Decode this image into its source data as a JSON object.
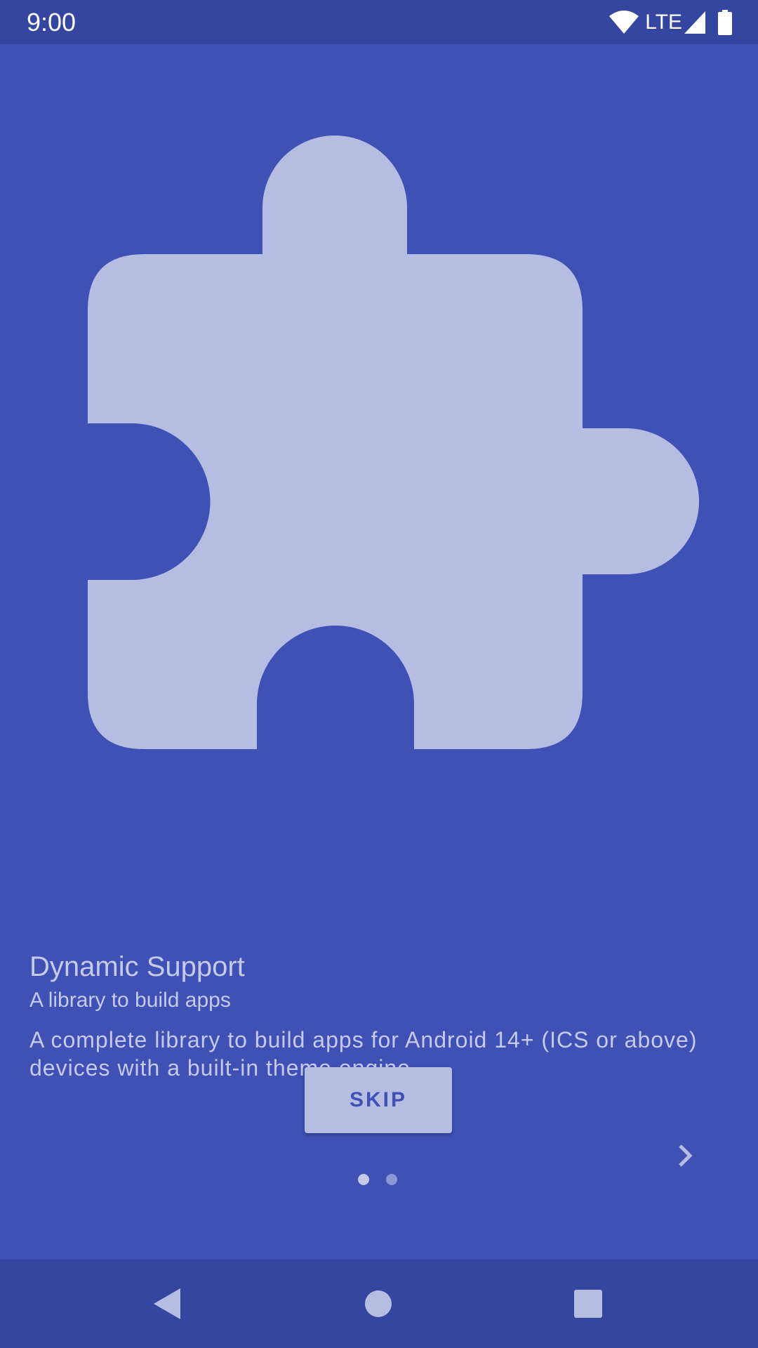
{
  "status_bar": {
    "time": "9:00",
    "network_label": "LTE",
    "icons": [
      "wifi-icon",
      "signal-icon",
      "battery-icon"
    ]
  },
  "intro": {
    "illustration_icon": "puzzle-piece-icon",
    "title": "Dynamic Support",
    "subtitle": "A library to build apps",
    "description": "A complete library to build apps for Android 14+ (ICS or above) devices with a built-in theme engine."
  },
  "controls": {
    "skip_label": "SKIP",
    "next_icon": "chevron-right-icon",
    "page_count": 2,
    "current_page": 1
  },
  "nav_bar": {
    "icons": [
      "back-icon",
      "home-icon",
      "recents-icon"
    ]
  },
  "colors": {
    "background": "#3f51b5",
    "bars": "#3546a0",
    "accent_light": "#b6bde3",
    "text": "#c5cae9"
  }
}
